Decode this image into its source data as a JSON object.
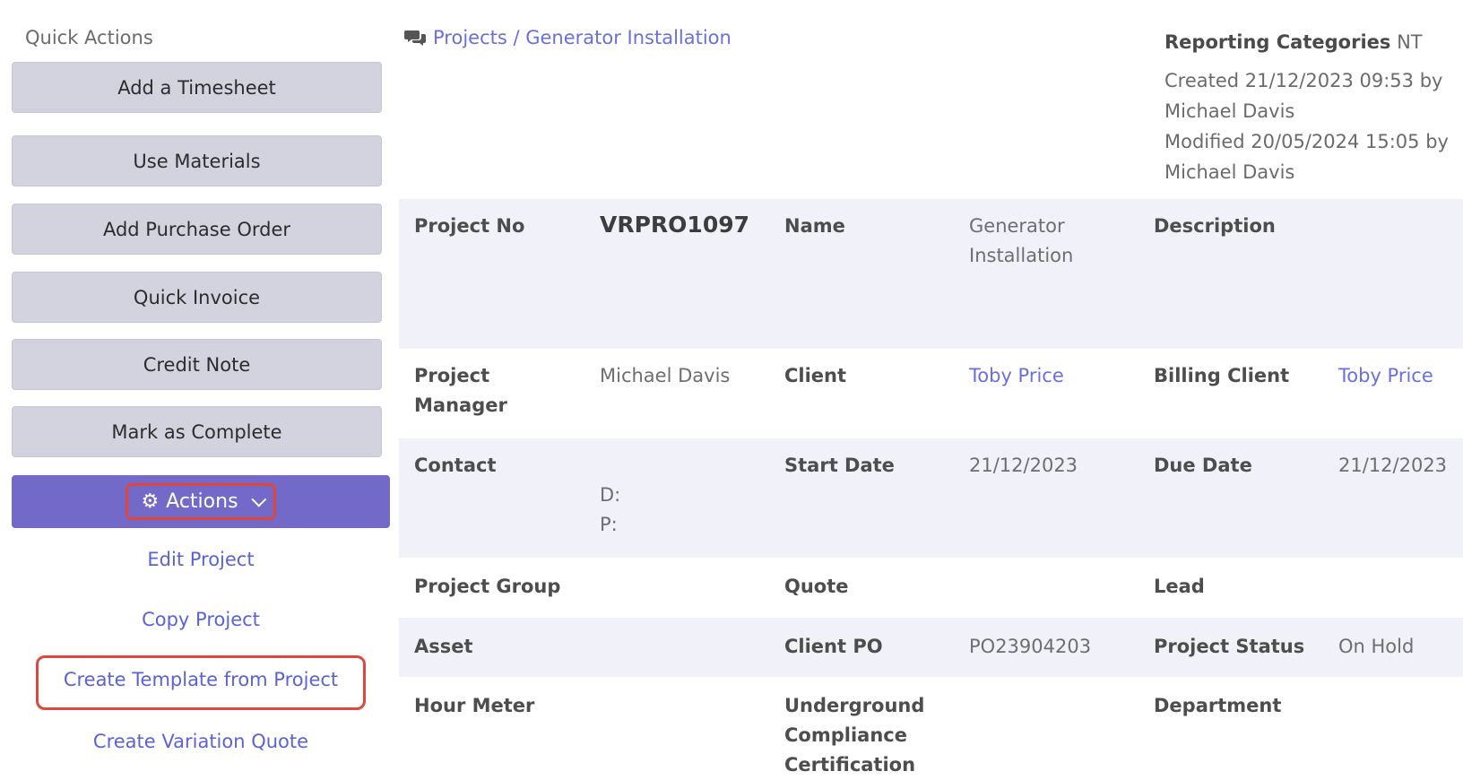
{
  "quick_actions": {
    "title": "Quick Actions",
    "buttons": [
      "Add a Timesheet",
      "Use Materials",
      "Add Purchase Order",
      "Quick Invoice",
      "Credit Note",
      "Mark as Complete"
    ],
    "actions_label": "Actions",
    "menu_items": [
      "Edit Project",
      "Copy Project",
      "Create Template from Project",
      "Create Variation Quote"
    ]
  },
  "breadcrumb": {
    "text": "Projects / Generator Installation"
  },
  "meta": {
    "reporting_label": "Reporting Categories",
    "reporting_value": "NT",
    "created_line1": "Created 21/12/2023 09:53 by",
    "created_line2": "Michael Davis",
    "modified_line1": "Modified 20/05/2024 15:05 by",
    "modified_line2": "Michael Davis"
  },
  "details": {
    "project_no_label": "Project No",
    "project_no": "VRPRO1097",
    "name_label": "Name",
    "name_line1": "Generator",
    "name_line2": "Installation",
    "description_label": "Description",
    "pm_label_line1": "Project",
    "pm_label_line2": "Manager",
    "pm": "Michael Davis",
    "client_label": "Client",
    "client": "Toby Price",
    "billing_client_label": "Billing Client",
    "billing_client": "Toby Price",
    "contact_label": "Contact",
    "contact_d": "D:",
    "contact_p": "P:",
    "start_date_label": "Start Date",
    "start_date": "21/12/2023",
    "due_date_label": "Due Date",
    "due_date": "21/12/2023",
    "project_group_label": "Project Group",
    "quote_label": "Quote",
    "lead_label": "Lead",
    "asset_label": "Asset",
    "client_po_label": "Client PO",
    "client_po": "PO23904203",
    "project_status_label": "Project Status",
    "project_status": "On Hold",
    "hour_meter_label": "Hour Meter",
    "ucc_line1": "Underground",
    "ucc_line2": "Compliance",
    "ucc_line3": "Certification",
    "department_label": "Department"
  },
  "colors": {
    "accent": "#7369c8",
    "link": "#6a6fe0",
    "highlight": "#e0473c",
    "button_bg": "#d3d3e0",
    "row_shade": "#f1f1fa"
  }
}
